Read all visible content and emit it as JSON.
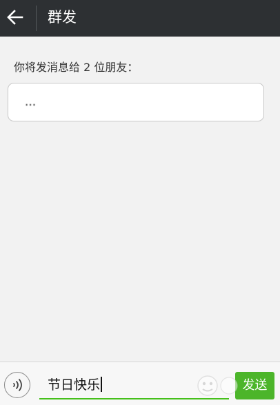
{
  "header": {
    "title": "群发",
    "back_icon": "arrow-left-icon"
  },
  "main": {
    "prompt": "你将发消息给 2 位朋友：",
    "recipients": "..."
  },
  "composer": {
    "voice_icon": "voice-wave-icon",
    "message": "节日快乐",
    "send_label": "发送"
  },
  "colors": {
    "topbar": "#2d3033",
    "background": "#f2f2f2",
    "accent_green": "#4cb52a",
    "input_underline": "#45c01a"
  }
}
